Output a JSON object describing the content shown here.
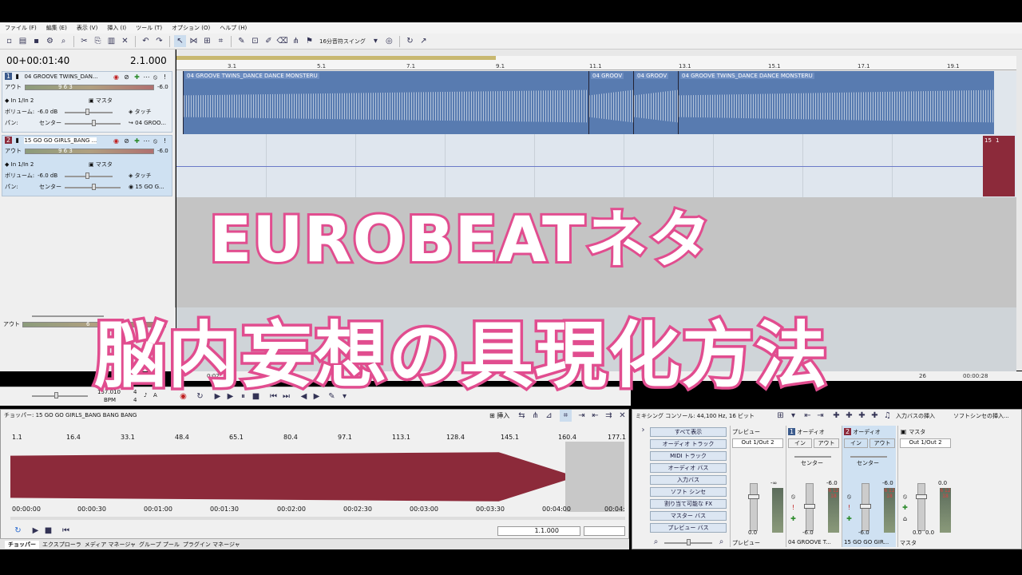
{
  "menu": [
    "ファイル (F)",
    "編集 (E)",
    "表示 (V)",
    "挿入 (I)",
    "ツール (T)",
    "オプション (O)",
    "ヘルプ (H)"
  ],
  "toolbar": {
    "swing_label": "16分音符スイング"
  },
  "timecode": "00+00:01:40",
  "beat_position": "2.1.000",
  "ruler_marks": [
    "3.1",
    "5.1",
    "7.1",
    "9.1",
    "11.1",
    "13.1",
    "15.1",
    "17.1",
    "19.1"
  ],
  "tracks": [
    {
      "number": "1",
      "name": "04 GROOVE TWINS_DAN...",
      "out_label": "アウト",
      "meter_ticks": "9   6   3",
      "out_value": "-6.0",
      "input": "In 1/In 2",
      "mask": "マスタ",
      "volume_label": "ボリューム:",
      "volume": "-6.0 dB",
      "touch": "タッチ",
      "pan_label": "パン:",
      "pan": "センター",
      "route": "04 GROO..."
    },
    {
      "number": "2",
      "name": "15 GO GO GIRLS_BANG ...",
      "out_label": "アウト",
      "meter_ticks": "9   6   3",
      "out_value": "-6.0",
      "input": "In 1/In 2",
      "mask": "マスタ",
      "volume_label": "ボリューム:",
      "volume": "-6.0 dB",
      "touch": "タッチ",
      "pan_label": "パン:",
      "pan": "センター",
      "route": "15 GO G..."
    }
  ],
  "clips": [
    {
      "label": "04 GROOVE TWINS_DANCE DANCE MONSTERU"
    },
    {
      "label": "04 GROOV"
    },
    {
      "label": "04 GROOV"
    },
    {
      "label": "04 GROOVE TWINS_DANCE DANCE MONSTERU"
    }
  ],
  "clip2_label": "15",
  "clip2_fx": "1",
  "lower_panel": {
    "out_label": "アウト",
    "value": "6"
  },
  "bottom_ruler": {
    "left": "0:02",
    "mid": "26",
    "right": "00:00:28"
  },
  "tempo": {
    "value": "157.010",
    "label": "BPM",
    "sig_top": "4",
    "sig_bottom": "4",
    "sig_letter": "A"
  },
  "overlay": {
    "line1": "EUROBEATネタ",
    "line2": "脳内妄想の具現化方法"
  },
  "chopper": {
    "title": "チョッパー: 15 GO GO GIRLS_BANG BANG BANG",
    "insert": "挿入",
    "ruler": [
      "1.1",
      "16.4",
      "33.1",
      "48.4",
      "65.1",
      "80.4",
      "97.1",
      "113.1",
      "128.4",
      "145.1",
      "160.4",
      "177.1"
    ],
    "times": [
      "00:00:00",
      "00:00:30",
      "00:01:00",
      "00:01:30",
      "00:02:00",
      "00:02:30",
      "00:03:00",
      "00:03:30",
      "00:04:00",
      "00:04:"
    ],
    "position": "1.1.000"
  },
  "tabs": [
    "チョッパー",
    "エクスプローラ",
    "メディア マネージャ",
    "グループ プール",
    "プラグイン マネージャ"
  ],
  "mixer": {
    "title": "ミキシング コンソール: 44,100 Hz, 16 ビット",
    "insert_bus": "入力バスの挿入",
    "insert_synth": "ソフトシンセの挿入...",
    "buttons": [
      "すべて表示",
      "オーディオ トラック",
      "MIDI トラック",
      "オーディオ バス",
      "入力バス",
      "ソフト シンセ",
      "割り当て可能な FX",
      "マスター バス",
      "プレビュー バス"
    ],
    "strips": [
      {
        "header": "プレビュー",
        "route": "Out 1/Out 2",
        "in": "",
        "out": "",
        "pan": "",
        "fader_val": "0.0",
        "peak": "",
        "vu": "",
        "name": "プレビュー"
      },
      {
        "header": "オーディオ",
        "num": "1",
        "route": "",
        "in": "イン",
        "out": "アウト",
        "pan": "センター",
        "fader_val": "-6.0",
        "peak": "-6.0",
        "vu": "6 12 18",
        "name": "04 GROOVE T..."
      },
      {
        "header": "オーディオ",
        "num": "2",
        "route": "",
        "in": "イン",
        "out": "アウト",
        "pan": "センター",
        "fader_val": "-6.0",
        "peak": "-6.0",
        "vu": "6 12 18",
        "name": "15 GO GO GIR..."
      },
      {
        "header": "マスタ",
        "route": "Out 1/Out 2",
        "in": "",
        "out": "",
        "pan": "",
        "fader_val": "0.0",
        "fader_val2": "0.0",
        "peak": "0.0",
        "vu": "6 12 18",
        "name": "マスタ"
      }
    ],
    "minus_inf": "-∞"
  }
}
